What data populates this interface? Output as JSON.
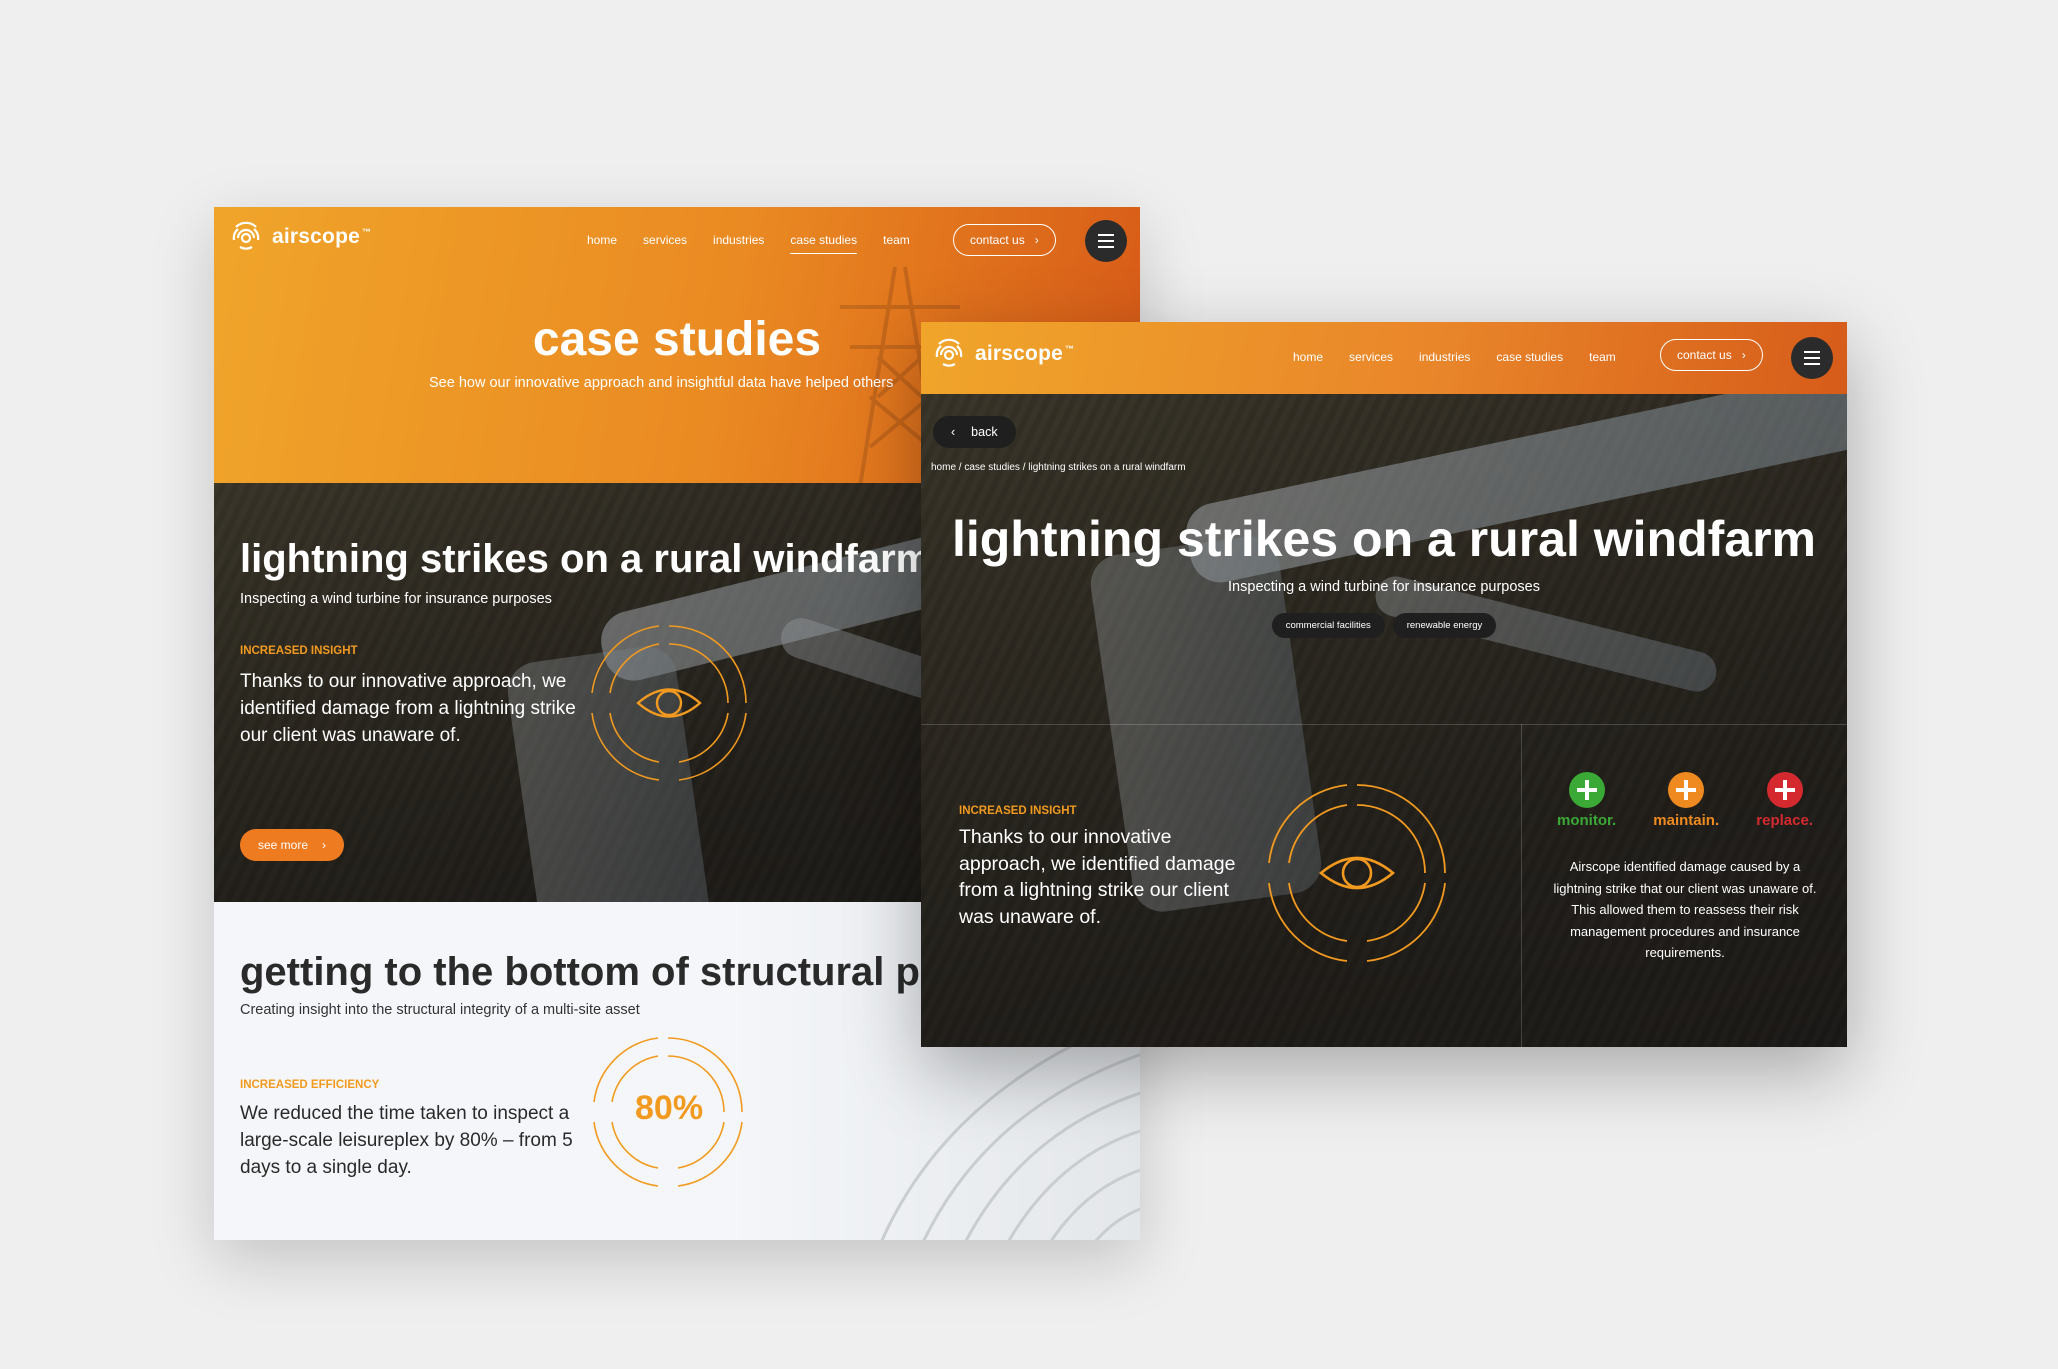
{
  "brand": {
    "name": "airscope",
    "trademark": "™"
  },
  "nav": {
    "items": [
      {
        "label": "home"
      },
      {
        "label": "services"
      },
      {
        "label": "industries"
      },
      {
        "label": "case studies"
      },
      {
        "label": "team"
      }
    ],
    "active": "case studies",
    "contact_label": "contact us"
  },
  "listing": {
    "title": "case studies",
    "subtitle": "See how our innovative approach and insightful data have helped others",
    "case1": {
      "title": "lightning strikes on a rural windfarm",
      "subtitle": "Inspecting a wind turbine for insurance purposes",
      "kicker": "INCREASED INSIGHT",
      "body": "Thanks to our innovative approach, we identified damage from a lightning strike our client was unaware of.",
      "cta": "see more"
    },
    "case2": {
      "title": "getting to the bottom of structural p",
      "subtitle": "Creating insight into the structural integrity of a multi-site asset",
      "kicker": "INCREASED EFFICIENCY",
      "body": "We reduced the time taken to inspect a large-scale leisureplex by 80% – from 5 days to a single day.",
      "stat": "80%"
    }
  },
  "detail": {
    "back_label": "back",
    "breadcrumb": "home / case studies / lightning strikes on a rural windfarm",
    "title": "lightning strikes on a rural windfarm",
    "subtitle": "Inspecting a wind turbine for insurance purposes",
    "tags": [
      "commercial facilities",
      "renewable energy"
    ],
    "kicker": "INCREASED INSIGHT",
    "body": "Thanks to our innovative approach, we identified damage from a lightning strike our client was unaware of.",
    "actions": [
      {
        "label": "monitor.",
        "color": "#3aa935"
      },
      {
        "label": "maintain.",
        "color": "#ee8a1f"
      },
      {
        "label": "replace.",
        "color": "#d42a2f"
      }
    ],
    "description": "Airscope identified damage caused by a lightning strike that our client was unaware of. This allowed them to reassess their risk management procedures and insurance requirements."
  },
  "colors": {
    "accent": "#f29a1f",
    "header_gradient_start": "#f0a52a",
    "header_gradient_end": "#d65c19",
    "dark": "#2c2925"
  },
  "icons": [
    "airscope-logo-icon",
    "chevron-right-icon",
    "chevron-left-icon",
    "menu-icon",
    "eye-icon",
    "plus-icon"
  ]
}
